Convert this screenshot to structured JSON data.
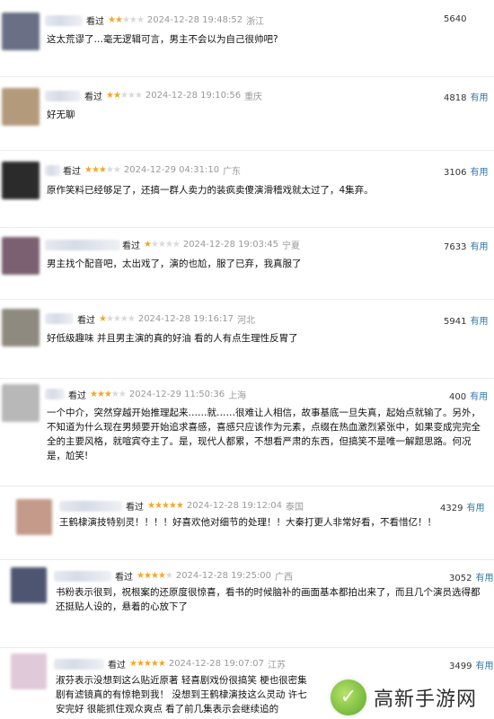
{
  "reviews": [
    {
      "seen": "看过",
      "stars": 2,
      "date": "2024-12-28 19:48:52",
      "loc": "浙江",
      "count": "5640",
      "useful": "",
      "text": "这太荒谬了…毫无逻辑可言，男主不会以为自己很帅吧?",
      "avatar_color": "#6a6f86"
    },
    {
      "seen": "看过",
      "stars": 2,
      "date": "2024-12-28 19:10:56",
      "loc": "重庆",
      "count": "4818",
      "useful": "有用",
      "text": "好无聊",
      "avatar_color": "#b39a7a"
    },
    {
      "seen": "看过",
      "stars": 3,
      "date": "2024-12-29 04:31:10",
      "loc": "广东",
      "count": "3106",
      "useful": "有用",
      "text": "原作笑料已经够足了，还搞一群人卖力的装疯卖傻演滑稽戏就太过了，4集弃。",
      "avatar_color": "#2b2b2b"
    },
    {
      "seen": "看过",
      "stars": 1,
      "date": "2024-12-28 19:03:45",
      "loc": "宁夏",
      "count": "7633",
      "useful": "有用",
      "text": "男主找个配音吧，太出戏了，演的也尬，服了已弃，我真服了",
      "avatar_color": "#7a6070"
    },
    {
      "seen": "看过",
      "stars": 1,
      "date": "2024-12-28 19:16:17",
      "loc": "河北",
      "count": "5941",
      "useful": "有用",
      "text": "好低级趣味 并且男主演的真的好油 看的人有点生理性反胃了",
      "avatar_color": "#8f8a80"
    },
    {
      "seen": "看过",
      "stars": 3,
      "date": "2024-12-29 11:50:36",
      "loc": "上海",
      "count": "400",
      "useful": "有用",
      "text": "一个中介，突然穿越开始推理起来……就……很难让人相信，故事基底一旦失真，起始点就输了。另外，不知道为什么现在男频要开始追求喜感，喜感只应该作为元素，点缀在热血激烈紧张中，如果变成完完全全的主要风格，就喧宾夺主了。是，现代人都累，不想看严肃的东西，但搞笑不是唯一解题思路。何况是，尬笑!",
      "avatar_color": "#b8b8b8"
    },
    {
      "seen": "看过",
      "stars": 5,
      "date": "2024-12-28 19:12:04",
      "loc": "泰国",
      "count": "4329",
      "useful": "有用",
      "text": "王鹤棣演技特别灵！！！！好喜欢他对细节的处理！！大秦打更人非常好看，不看惜亿！！",
      "avatar_color": "#c49a8a"
    },
    {
      "seen": "看过",
      "stars": 4,
      "date": "2024-12-28 19:25:00",
      "loc": "广西",
      "count": "3052",
      "useful": "有用",
      "text": "书粉表示很到，祝根案的还原度很惊喜，看书的时候脑补的画面基本都拍出来了，而且几个演员选得都还挺贴人设的，悬着的心放下了",
      "avatar_color": "#4d5570"
    },
    {
      "seen": "看过",
      "stars": 5,
      "date": "2024-12-28 19:07:07",
      "loc": "江苏",
      "count": "3499",
      "useful": "有用",
      "text": "淑芬表示没想到这么贴近原著 轻喜剧戏份很搞笑 梗也很密集 剧有滤镜真的有惊艳到我！ 没想到王鹤棣演技这么灵动 许七安完好 很能抓住观众爽点 看了前几集表示会继续追的",
      "avatar_color": "#e0c9d8"
    }
  ],
  "watermark": {
    "logo_glyph": "✓",
    "text": "高新手游网"
  }
}
